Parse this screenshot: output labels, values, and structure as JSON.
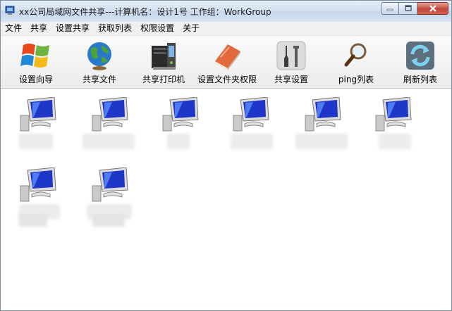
{
  "window": {
    "title": "xx公司局域网文件共享---计算机名：设计1号  工作组：WorkGroup"
  },
  "menu": [
    "文件",
    "共享",
    "设置共享",
    "获取列表",
    "权限设置",
    "关于"
  ],
  "toolbar": {
    "setup_wizard": "设置向导",
    "share_file": "共享文件",
    "share_printer": "共享打印机",
    "folder_permissions": "设置文件夹权限",
    "share_settings": "共享设置",
    "ping_list": "ping列表",
    "refresh_list": "刷新列表"
  },
  "computers": [
    {
      "name": ""
    },
    {
      "name": ""
    },
    {
      "name": ""
    },
    {
      "name": ""
    },
    {
      "name": ""
    },
    {
      "name": ""
    },
    {
      "name": ""
    },
    {
      "name": ""
    }
  ],
  "colors": {
    "titlebar": "#d3e0ef",
    "close": "#c2473a",
    "content_bg": "#ffffff"
  }
}
